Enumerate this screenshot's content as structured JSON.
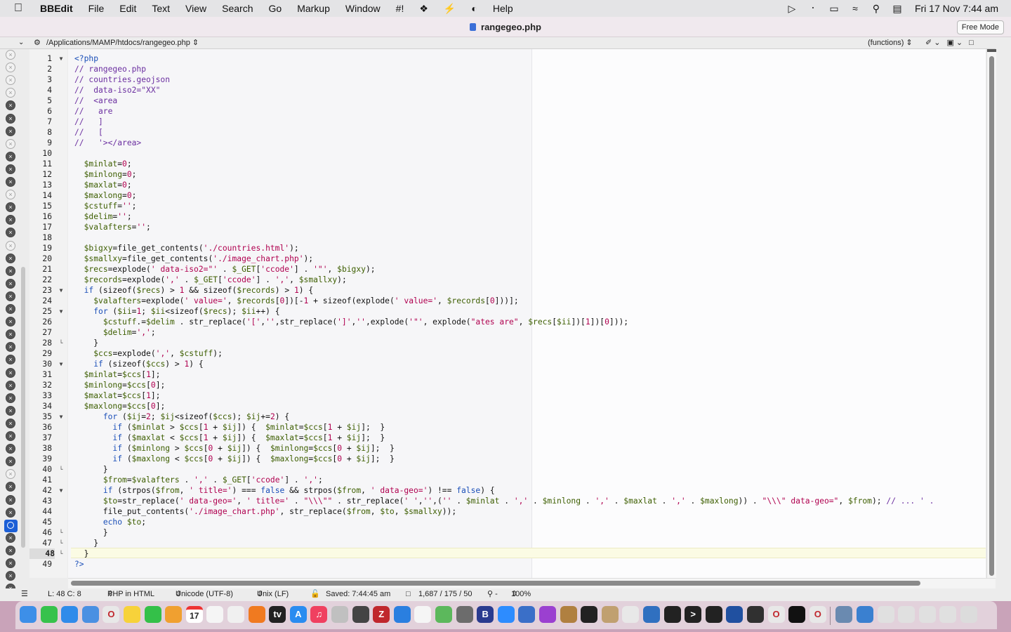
{
  "menubar": {
    "apple": "",
    "app_name": "BBEdit",
    "items": [
      "File",
      "Edit",
      "Text",
      "View",
      "Search",
      "Go",
      "Markup",
      "Window",
      "#!"
    ],
    "help": "Help",
    "datetime": "Fri 17 Nov  7:44 am"
  },
  "window": {
    "title": "rangegeo.php",
    "free_mode_label": "Free Mode"
  },
  "pathbar": {
    "path": "/Applications/MAMP/htdocs/rangegeo.php",
    "functions": "(functions)"
  },
  "editor": {
    "current_line": 48,
    "lines": [
      "<?php",
      "// rangegeo.php",
      "// countries.geojson",
      "//  data-iso2=\"XX\"",
      "//  <area",
      "//   are",
      "//   ]",
      "//   [",
      "//   '></area>",
      "",
      "  $minlat=0;",
      "  $minlong=0;",
      "  $maxlat=0;",
      "  $maxlong=0;",
      "  $cstuff='';",
      "  $delim='';",
      "  $valafters='';",
      "",
      "  $bigxy=file_get_contents('./countries.html');",
      "  $smallxy=file_get_contents('./image_chart.php');",
      "  $recs=explode(' data-iso2=\"' . $_GET['ccode'] . '\"', $bigxy);",
      "  $records=explode(',' . $_GET['ccode'] . ',', $smallxy);",
      "  if (sizeof($recs) > 1 && sizeof($records) > 1) {",
      "    $valafters=explode(' value=', $records[0])[-1 + sizeof(explode(' value=', $records[0]))];",
      "    for ($ii=1; $ii<sizeof($recs); $ii++) {",
      "      $cstuff.=$delim . str_replace('[','',str_replace(']','',explode('\"', explode(\"ates are\", $recs[$ii])[1])[0]));",
      "      $delim=',';",
      "    }",
      "    $ccs=explode(',', $cstuff);",
      "    if (sizeof($ccs) > 1) {",
      "  $minlat=$ccs[1];",
      "  $minlong=$ccs[0];",
      "  $maxlat=$ccs[1];",
      "  $maxlong=$ccs[0];",
      "      for ($ij=2; $ij<sizeof($ccs); $ij+=2) {",
      "        if ($minlat > $ccs[1 + $ij]) {  $minlat=$ccs[1 + $ij];  }",
      "        if ($maxlat < $ccs[1 + $ij]) {  $maxlat=$ccs[1 + $ij];  }",
      "        if ($minlong > $ccs[0 + $ij]) {  $minlong=$ccs[0 + $ij];  }",
      "        if ($maxlong < $ccs[0 + $ij]) {  $maxlong=$ccs[0 + $ij];  }",
      "      }",
      "      $from=$valafters . ',' . $_GET['ccode'] . ',';",
      "      if (strpos($from, ' title=') === false && strpos($from, ' data-geo=') !== false) {",
      "      $to=str_replace(' data-geo=', ' title=' . \"\\\\\\\"\" . str_replace(' ','',('' . $minlat . ',' . $minlong . ',' . $maxlat . ',' . $maxlong)) . \"\\\\\\\" data-geo=\", $from); // ... ' .",
      "      file_put_contents('./image_chart.php', str_replace($from, $to, $smallxy));",
      "      echo $to;",
      "      }",
      "    }",
      "  }",
      "?>"
    ]
  },
  "status": {
    "position": "L: 48 C: 8",
    "language": "PHP in HTML",
    "encoding": "Unicode (UTF-8)",
    "line_endings": "Unix (LF)",
    "saved": "Saved: 7:44:45 am",
    "counts": "1,687 / 175 / 50",
    "zoom": "100%"
  },
  "dock": {
    "calendar_day": "17"
  },
  "colors": {
    "comment": "#6b2fa0",
    "keyword": "#1b4fb8",
    "variable": "#3d5e00",
    "string": "#b0004f",
    "selection": "#1c5fd6"
  }
}
